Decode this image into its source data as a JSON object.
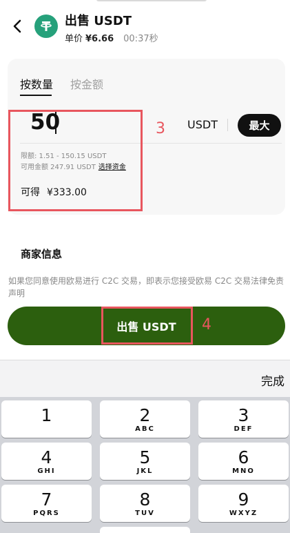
{
  "header": {
    "title": "出售 USDT",
    "price_label": "单价",
    "price_value": "¥6.66",
    "timer": "00:37秒"
  },
  "tabs": {
    "by_quantity": "按数量",
    "by_amount": "按金额"
  },
  "amount_input": {
    "value": "50",
    "unit": "USDT",
    "max_label": "最大"
  },
  "limits": {
    "limit_text": "限额: 1.51 - 150.15 USDT",
    "available_text": "可用金额 247.91 USDT",
    "select_funds": "选择资金"
  },
  "receive": {
    "label": "可得",
    "value": "¥333.00"
  },
  "merchant": {
    "title": "商家信息"
  },
  "disclaimer": "如果您同意使用欧易进行 C2C 交易，即表示您接受欧易 C2C 交易法律免责声明",
  "sell_button": "出售 USDT",
  "annotations": {
    "marker_3": "3",
    "marker_4": "4"
  },
  "keyboard": {
    "done_label": "完成",
    "keys": [
      {
        "digit": "1",
        "letters": ""
      },
      {
        "digit": "2",
        "letters": "ABC"
      },
      {
        "digit": "3",
        "letters": "DEF"
      },
      {
        "digit": "4",
        "letters": "GHI"
      },
      {
        "digit": "5",
        "letters": "JKL"
      },
      {
        "digit": "6",
        "letters": "MNO"
      },
      {
        "digit": "7",
        "letters": "PQRS"
      },
      {
        "digit": "8",
        "letters": "TUV"
      },
      {
        "digit": "9",
        "letters": "WXYZ"
      }
    ]
  },
  "colors": {
    "sell_button": "#2c5f0e",
    "highlight": "#e8565e",
    "tether": "#26a17b"
  },
  "icons": {
    "back": "chevron-left-icon",
    "coin": "tether-icon"
  }
}
